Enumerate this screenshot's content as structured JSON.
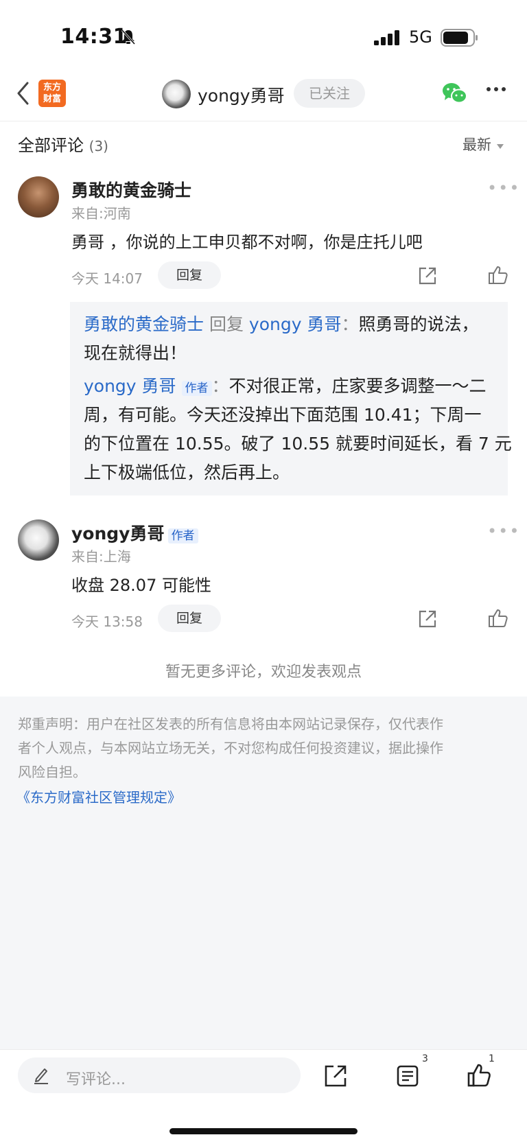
{
  "status_bar": {
    "time": "14:31",
    "network": "5G"
  },
  "nav": {
    "logo_line1": "东方",
    "logo_line2": "财富",
    "user_name": "yongy勇哥",
    "follow_label": "已关注"
  },
  "section": {
    "title": "全部评论",
    "count": "(3)",
    "sort_label": "最新"
  },
  "comments": [
    {
      "user": "勇敢的黄金骑士",
      "location": "来自:河南",
      "text": "勇哥 ，你说的上工申贝都不对啊，你是庄托儿吧",
      "time": "今天 14:07",
      "reply_label": "回复"
    },
    {
      "user": "yongy勇哥",
      "author_tag": "作者",
      "location": "来自:上海",
      "text": "收盘 28.07 可能性",
      "time": "今天 13:58",
      "reply_label": "回复"
    }
  ],
  "quote": {
    "from_user": "勇敢的黄金骑士",
    "reply_word": " 回复 ",
    "to_user": "yongy 勇哥",
    "colon": "：",
    "line1_text": "照勇哥的说法，",
    "line2_text": "现在就得出！",
    "author_user": "yongy 勇哥",
    "author_tag": "作者",
    "author_line1_text": "不对很正常，庄家要多调整一～二",
    "author_line2": "周，有可能。今天还没掉出下面范围 10.41；下周一",
    "author_line3": "的下位置在 10.55。破了 10.55 就要时间延长，看 7 元",
    "author_line4": "上下极端低位，然后再上。"
  },
  "no_more": "暂无更多评论，欢迎发表观点",
  "disclaimer": {
    "line1": "郑重声明：用户在社区发表的所有信息将由本网站记录保存，仅代表作",
    "line2": "者个人观点，与本网站立场无关，不对您构成任何投资建议，据此操作",
    "line3": "风险自担。",
    "rules_link": "《东方财富社区管理规定》"
  },
  "bottom_bar": {
    "placeholder": "写评论...",
    "comment_count": "3",
    "like_count": "1"
  },
  "colors": {
    "accent_blue": "#2a6ac8",
    "logo_orange": "#f26a21",
    "wechat_green": "#3fc55a"
  }
}
